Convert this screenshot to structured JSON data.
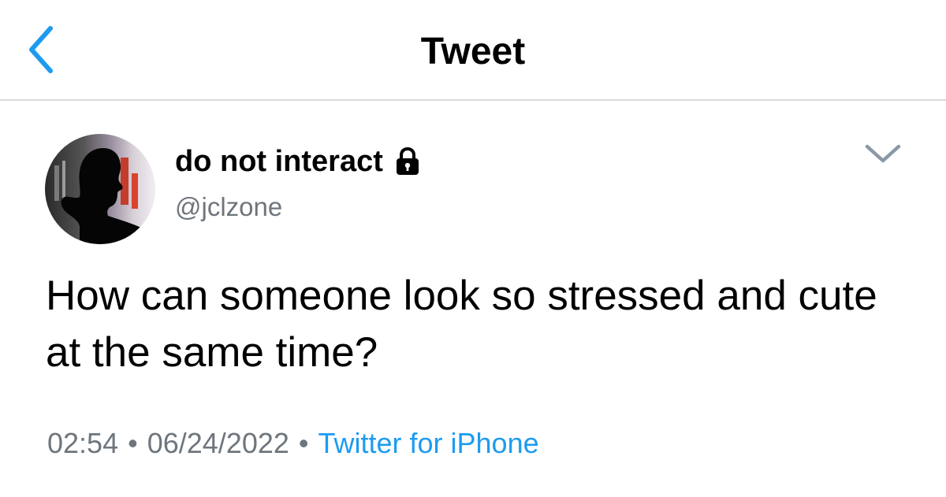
{
  "header": {
    "title": "Tweet",
    "back_icon": "chevron-left-icon",
    "accent_color": "#1d9bf0"
  },
  "tweet": {
    "author": {
      "display_name": "do not interact",
      "handle": "@jclzone",
      "protected_icon": "lock-icon",
      "avatar_icon": "silhouette-avatar"
    },
    "more_icon": "chevron-down-icon",
    "text": "How can someone look so stressed and cute at the same time?",
    "time": "02:54",
    "date": "06/24/2022",
    "separator": "•",
    "source": "Twitter for iPhone"
  }
}
